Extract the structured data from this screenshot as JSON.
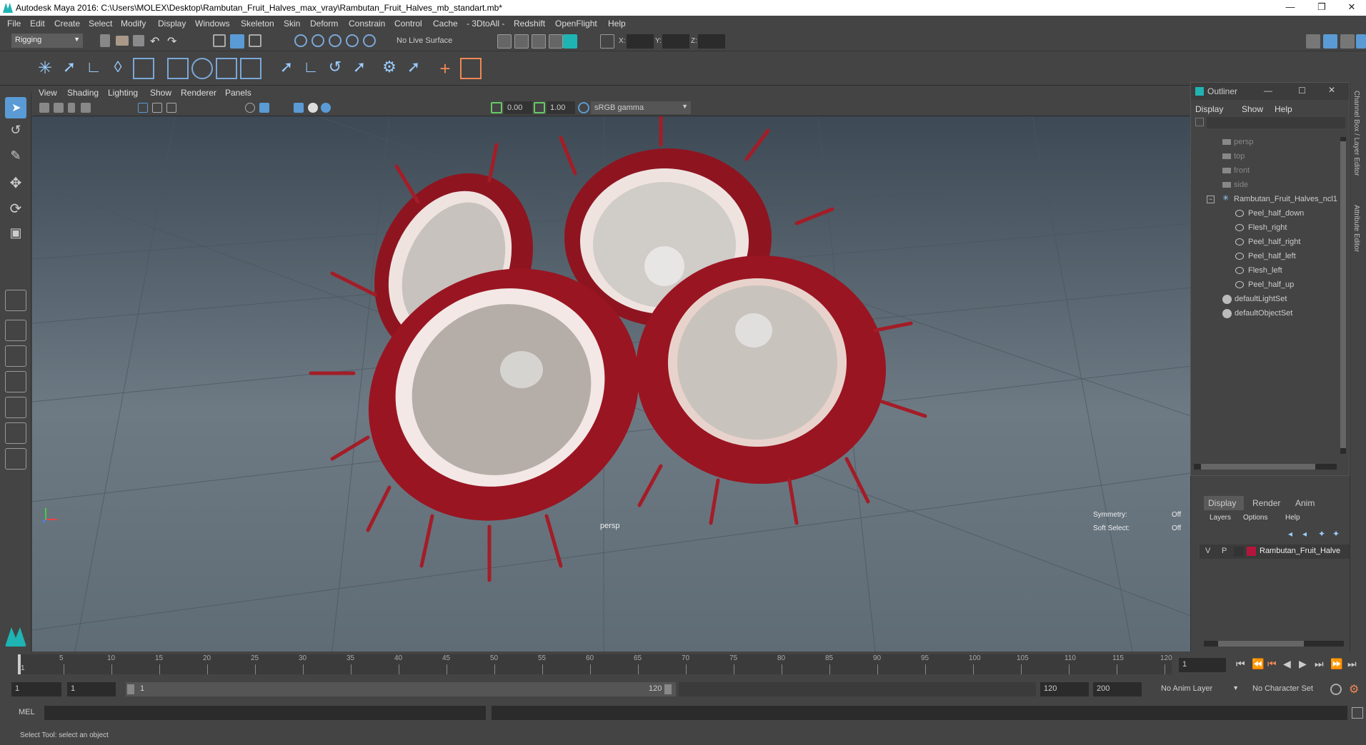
{
  "window": {
    "title": "Autodesk Maya 2016: C:\\Users\\MOLEX\\Desktop\\Rambutan_Fruit_Halves_max_vray\\Rambutan_Fruit_Halves_mb_standart.mb*"
  },
  "menubar": [
    "File",
    "Edit",
    "Create",
    "Select",
    "Modify",
    "Display",
    "Windows",
    "Skeleton",
    "Skin",
    "Deform",
    "Constrain",
    "Control",
    "Cache",
    "- 3DtoAll -",
    "Redshift",
    "OpenFlight",
    "Help"
  ],
  "statusline": {
    "mode": "Rigging",
    "live_surface": "No Live Surface",
    "x_label": "X:",
    "y_label": "Y:",
    "z_label": "Z:"
  },
  "panel": {
    "menus": [
      "View",
      "Shading",
      "Lighting",
      "Show",
      "Renderer",
      "Panels"
    ],
    "exposure": "0.00",
    "gamma": "1.00",
    "color_space": "sRGB gamma"
  },
  "viewport": {
    "camera_label": "persp",
    "symmetry_label": "Symmetry:",
    "symmetry_value": "Off",
    "soft_select_label": "Soft Select:",
    "soft_select_value": "Off"
  },
  "outliner": {
    "title": "Outliner",
    "menus": [
      "Display",
      "Show",
      "Help"
    ],
    "cameras": [
      "persp",
      "top",
      "front",
      "side"
    ],
    "group": "Rambutan_Fruit_Halves_ncl1",
    "children": [
      "Peel_half_down",
      "Flesh_right",
      "Peel_half_right",
      "Peel_half_left",
      "Flesh_left",
      "Peel_half_up"
    ],
    "sets": [
      "defaultLightSet",
      "defaultObjectSet"
    ]
  },
  "layer_editor": {
    "tabs": [
      "Display",
      "Render",
      "Anim"
    ],
    "menus": [
      "Layers",
      "Options",
      "Help"
    ],
    "layer": {
      "v": "V",
      "p": "P",
      "name": "Rambutan_Fruit_Halve",
      "color": "#b3163a"
    }
  },
  "side_tabs": [
    "Channel Box / Layer Editor",
    "Attribute Editor"
  ],
  "timeslider": {
    "start_label": "1",
    "ticks": [
      "5",
      "10",
      "15",
      "20",
      "25",
      "30",
      "35",
      "40",
      "45",
      "50",
      "55",
      "60",
      "65",
      "70",
      "75",
      "80",
      "85",
      "90",
      "95",
      "100",
      "105",
      "110",
      "115",
      "120"
    ],
    "current_frame": "1"
  },
  "range": {
    "start": "1",
    "playback_start": "1",
    "slider_start": "1",
    "slider_end": "120",
    "playback_end": "120",
    "end": "200",
    "anim_layer": "No Anim Layer",
    "char_set": "No Character Set"
  },
  "cmdline": {
    "label": "MEL"
  },
  "helpline": {
    "text": "Select Tool: select an object"
  },
  "colors": {
    "accent": "#5a9bd5",
    "maya_teal": "#1fb4b4",
    "peel_red": "#a0182a"
  }
}
